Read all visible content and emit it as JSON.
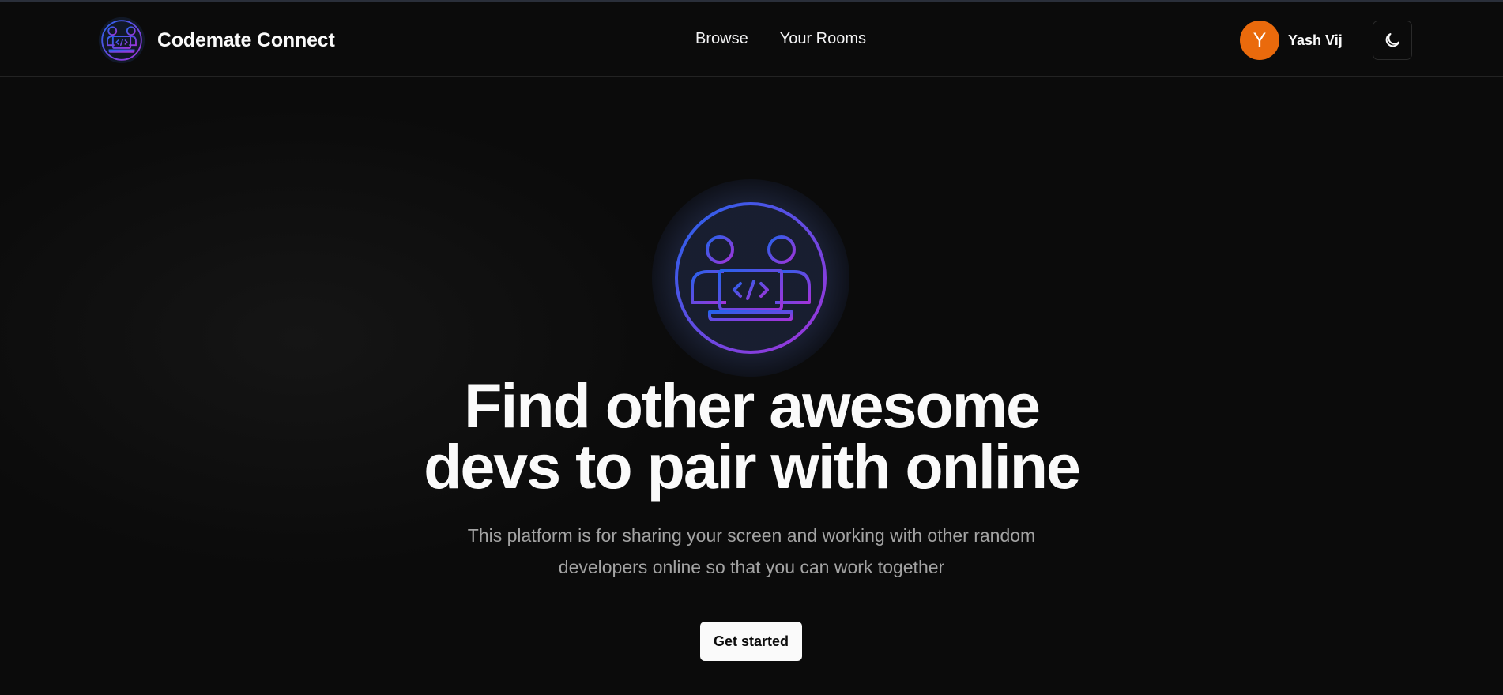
{
  "header": {
    "brand_title": "Codemate Connect",
    "brand_logo_icon": "pair-programming-logo-icon",
    "nav": [
      {
        "label": "Browse"
      },
      {
        "label": "Your Rooms"
      }
    ],
    "user": {
      "avatar_initial": "Y",
      "avatar_color": "#ea6a0c",
      "name": "Yash Vij"
    },
    "theme_toggle_icon": "moon-icon"
  },
  "hero": {
    "logo_icon": "pair-programming-logo-icon",
    "headline_line1": "Find other awesome",
    "headline_line2": "devs to pair with online",
    "subtitle_line1": "This platform is for sharing your screen and working with other random",
    "subtitle_line2": "developers online so that you can work together",
    "cta_label": "Get started"
  },
  "colors": {
    "background": "#0b0b0b",
    "text": "#fafafa",
    "muted_text": "#a3a3a3",
    "gradient_start": "#2563eb",
    "gradient_end": "#a233d9"
  }
}
